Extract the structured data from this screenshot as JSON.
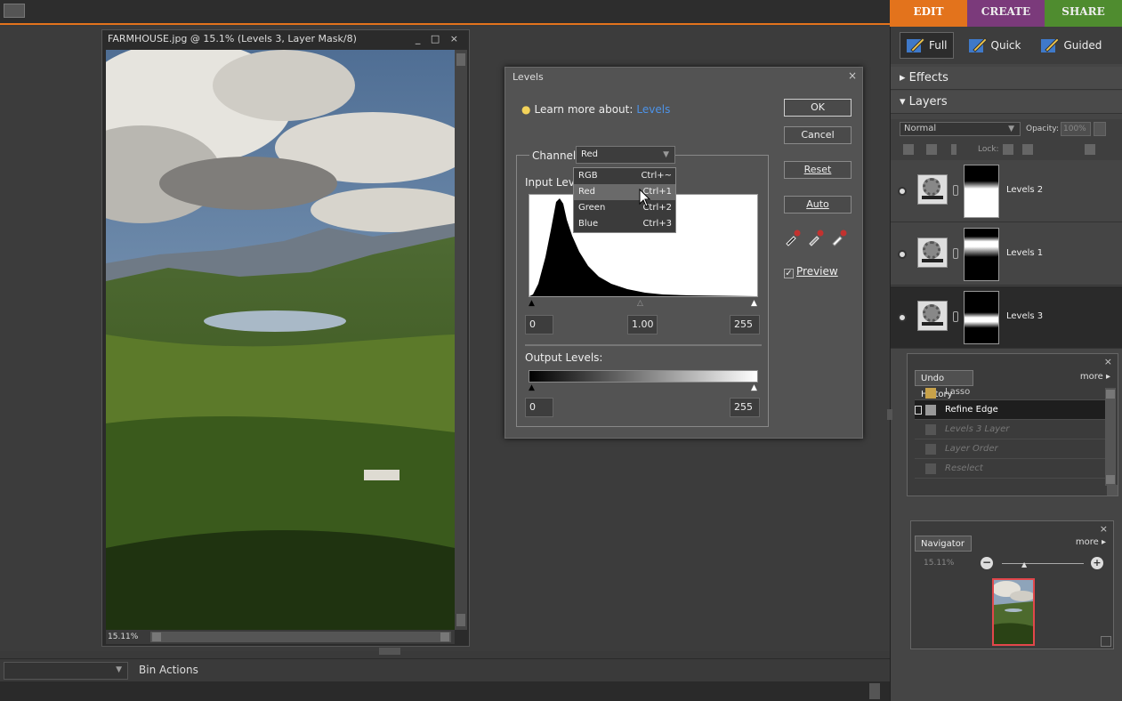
{
  "mode_tabs": {
    "edit": "EDIT",
    "create": "CREATE",
    "share": "SHARE"
  },
  "document": {
    "title": "FARMHOUSE.jpg @ 15.1% (Levels 3, Layer Mask/8)",
    "window_controls": "_ □ ×",
    "zoom": "15.11%"
  },
  "levels": {
    "title": "Levels",
    "close": "×",
    "learn_text": "Learn more about:",
    "learn_link": "Levels",
    "channel_label": "Channel:",
    "channel_value": "Red",
    "input_label": "Input Levels:",
    "input_black": "0",
    "input_gamma": "1.00",
    "input_white": "255",
    "output_label": "Output Levels:",
    "output_black": "0",
    "output_white": "255",
    "buttons": {
      "ok": "OK",
      "cancel": "Cancel",
      "reset": "Reset",
      "auto": "Auto"
    },
    "preview_label": "Preview",
    "preview_checked": "✓"
  },
  "channel_menu": [
    {
      "label": "RGB",
      "shortcut": "Ctrl+~"
    },
    {
      "label": "Red",
      "shortcut": "Ctrl+1"
    },
    {
      "label": "Green",
      "shortcut": "Ctrl+2"
    },
    {
      "label": "Blue",
      "shortcut": "Ctrl+3"
    }
  ],
  "edit_modes": {
    "full": "Full",
    "quick": "Quick",
    "guided": "Guided"
  },
  "panels": {
    "effects": "▸ Effects",
    "layers": "▾ Layers",
    "blend_mode": "Normal",
    "opacity_label": "Opacity:",
    "opacity_value": "100%",
    "lock_label": "Lock:"
  },
  "layers": [
    {
      "name": "Levels 2",
      "active": false
    },
    {
      "name": "Levels 1",
      "active": false
    },
    {
      "name": "Levels 3",
      "active": true
    }
  ],
  "undo_history": {
    "title": "Undo History",
    "more": "more ▸",
    "close": "×",
    "items": [
      {
        "label": "Lasso",
        "state": "partial"
      },
      {
        "label": "Refine Edge",
        "state": "current"
      },
      {
        "label": "Levels 3 Layer",
        "state": "dim"
      },
      {
        "label": "Layer Order",
        "state": "dim"
      },
      {
        "label": "Reselect",
        "state": "dim"
      }
    ]
  },
  "navigator": {
    "title": "Navigator",
    "more": "more ▸",
    "close": "×",
    "zoom": "15.11%",
    "zoom_out": "−",
    "zoom_in": "+"
  },
  "bin": {
    "actions": "Bin Actions"
  }
}
